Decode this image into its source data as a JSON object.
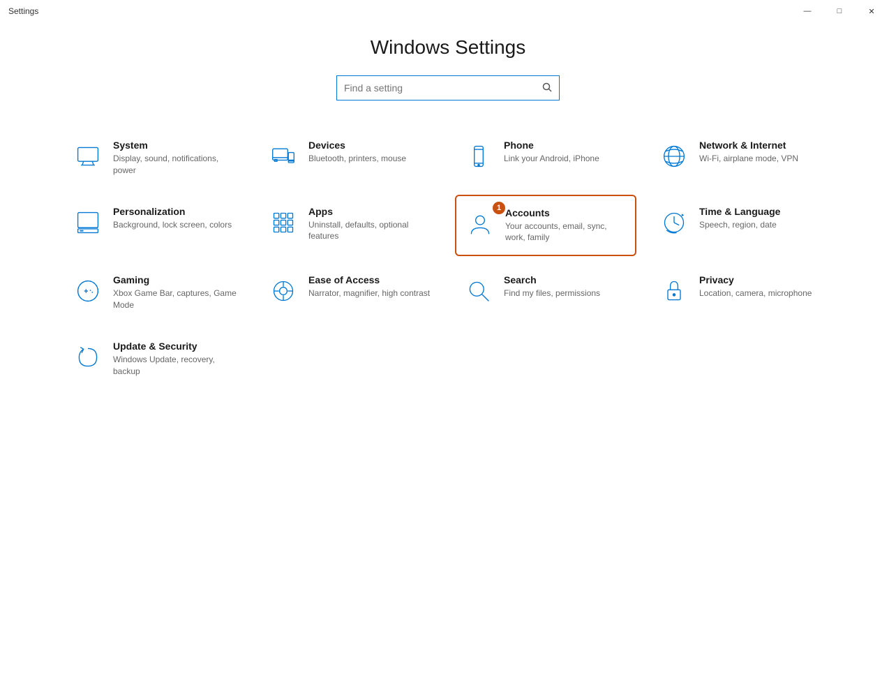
{
  "titleBar": {
    "title": "Settings",
    "minimize": "—",
    "maximize": "□",
    "close": "✕"
  },
  "page": {
    "title": "Windows Settings",
    "search": {
      "placeholder": "Find a setting"
    }
  },
  "settings": [
    {
      "id": "system",
      "title": "System",
      "desc": "Display, sound, notifications, power",
      "icon": "monitor-icon",
      "highlighted": false,
      "badge": null
    },
    {
      "id": "devices",
      "title": "Devices",
      "desc": "Bluetooth, printers, mouse",
      "icon": "devices-icon",
      "highlighted": false,
      "badge": null
    },
    {
      "id": "phone",
      "title": "Phone",
      "desc": "Link your Android, iPhone",
      "icon": "phone-icon",
      "highlighted": false,
      "badge": null
    },
    {
      "id": "network",
      "title": "Network & Internet",
      "desc": "Wi-Fi, airplane mode, VPN",
      "icon": "network-icon",
      "highlighted": false,
      "badge": null
    },
    {
      "id": "personalization",
      "title": "Personalization",
      "desc": "Background, lock screen, colors",
      "icon": "personalization-icon",
      "highlighted": false,
      "badge": null
    },
    {
      "id": "apps",
      "title": "Apps",
      "desc": "Uninstall, defaults, optional features",
      "icon": "apps-icon",
      "highlighted": false,
      "badge": null
    },
    {
      "id": "accounts",
      "title": "Accounts",
      "desc": "Your accounts, email, sync, work, family",
      "icon": "accounts-icon",
      "highlighted": true,
      "badge": "1"
    },
    {
      "id": "time",
      "title": "Time & Language",
      "desc": "Speech, region, date",
      "icon": "time-icon",
      "highlighted": false,
      "badge": null
    },
    {
      "id": "gaming",
      "title": "Gaming",
      "desc": "Xbox Game Bar, captures, Game Mode",
      "icon": "gaming-icon",
      "highlighted": false,
      "badge": null
    },
    {
      "id": "ease",
      "title": "Ease of Access",
      "desc": "Narrator, magnifier, high contrast",
      "icon": "ease-icon",
      "highlighted": false,
      "badge": null
    },
    {
      "id": "search",
      "title": "Search",
      "desc": "Find my files, permissions",
      "icon": "search-icon",
      "highlighted": false,
      "badge": null
    },
    {
      "id": "privacy",
      "title": "Privacy",
      "desc": "Location, camera, microphone",
      "icon": "privacy-icon",
      "highlighted": false,
      "badge": null
    },
    {
      "id": "update",
      "title": "Update & Security",
      "desc": "Windows Update, recovery, backup",
      "icon": "update-icon",
      "highlighted": false,
      "badge": null
    }
  ]
}
